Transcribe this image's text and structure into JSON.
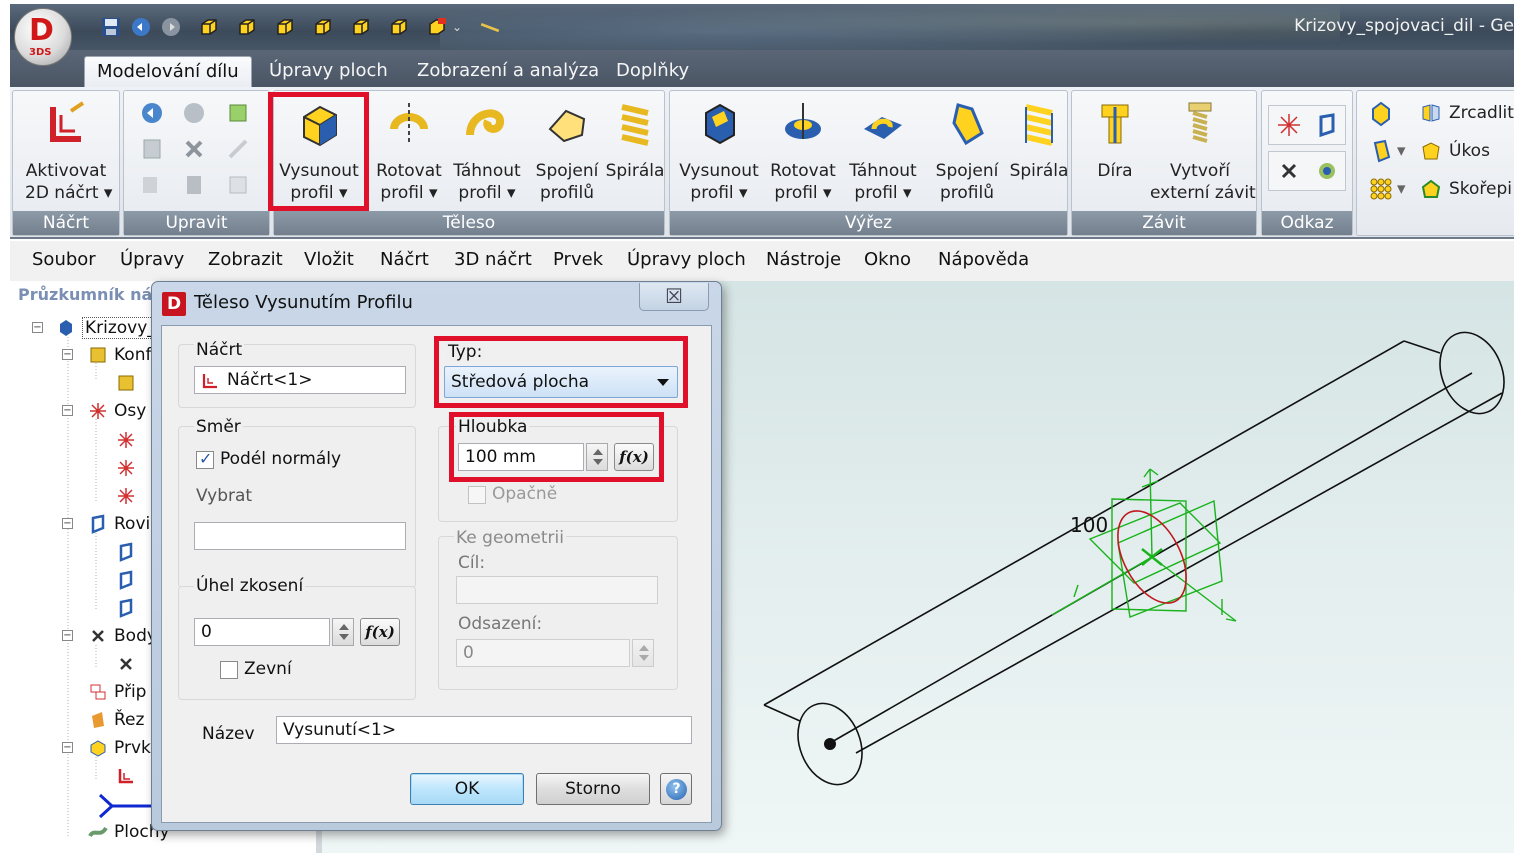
{
  "app": {
    "title": "Krizovy_spojovaci_dil - Ge",
    "orb_letter": "D",
    "orb_sub": "3DS"
  },
  "ribbon_tabs": [
    {
      "label": "Modelování dílu",
      "active": true
    },
    {
      "label": "Úpravy ploch",
      "active": false
    },
    {
      "label": "Zobrazení a analýza",
      "active": false
    },
    {
      "label": "Doplňky",
      "active": false
    }
  ],
  "ribbon": {
    "groups": {
      "nacrt": "Náčrt",
      "upravit": "Upravit",
      "teleso": "Těleso",
      "vyrez": "Výřez",
      "zavit": "Závit",
      "odkaz": "Odkaz"
    },
    "aktivovat": {
      "line1": "Aktivovat",
      "line2": "2D náčrt ▾"
    },
    "teleso_buttons": [
      {
        "line1": "Vysunout",
        "line2": "profil ▾"
      },
      {
        "line1": "Rotovat",
        "line2": "profil ▾"
      },
      {
        "line1": "Táhnout",
        "line2": "profil ▾"
      },
      {
        "line1": "Spojení",
        "line2": "profilů"
      },
      {
        "line1": "Spirála",
        "line2": ""
      }
    ],
    "vyrez_buttons": [
      {
        "line1": "Vysunout",
        "line2": "profil ▾"
      },
      {
        "line1": "Rotovat",
        "line2": "profil ▾"
      },
      {
        "line1": "Táhnout",
        "line2": "profil ▾"
      },
      {
        "line1": "Spojení",
        "line2": "profilů"
      },
      {
        "line1": "Spirála",
        "line2": ""
      }
    ],
    "zavit_buttons": [
      {
        "line1": "Díra",
        "line2": ""
      },
      {
        "line1": "Vytvoří",
        "line2": "externí závit"
      }
    ],
    "right_small": [
      "Zrcadlit",
      "Úkos",
      "Skořepi"
    ]
  },
  "menubar": [
    "Soubor",
    "Úpravy",
    "Zobrazit",
    "Vložit",
    "Náčrt",
    "3D náčrt",
    "Prvek",
    "Úpravy ploch",
    "Nástroje",
    "Okno",
    "Nápověda"
  ],
  "tree": {
    "title": "Průzkumník náv",
    "root": "Krizovy_",
    "nodes": [
      "Konf",
      "",
      "Osy",
      "",
      "",
      "",
      "Rovi",
      "",
      "",
      "",
      "Body",
      "",
      "Přip",
      "Řez",
      "Prvk",
      "",
      "Plochy"
    ]
  },
  "viewport": {
    "dimension_label": "100"
  },
  "dialog": {
    "title": "Těleso Vysunutím Profilu",
    "close_glyph": "☒",
    "nacrt": {
      "legend": "Náčrt",
      "value": "Náčrt<1>"
    },
    "smer": {
      "legend": "Směr",
      "podel_normaly": "Podél normály",
      "podel_checked": true,
      "vybrat": "Vybrat",
      "vybrat_value": ""
    },
    "uhel": {
      "legend": "Úhel zkosení",
      "value": "0",
      "zevni": "Zevní",
      "fx": "f(x)"
    },
    "typ": {
      "legend": "Typ:",
      "value": "Středová plocha"
    },
    "hloubka": {
      "legend": "Hloubka",
      "value": "100 mm",
      "fx": "f(x)",
      "opacne": "Opačně"
    },
    "ke_geometrii": {
      "legend": "Ke geometrii",
      "cil": "Cíl:",
      "cil_value": "",
      "odsazeni": "Odsazení:",
      "odsazeni_value": "0"
    },
    "nazev": {
      "label": "Název",
      "value": "Vysunutí<1>"
    },
    "ok": "OK",
    "storno": "Storno",
    "help": "?"
  },
  "colors": {
    "highlight": "#e0102a",
    "sketch_green": "#19b31b",
    "sketch_red": "#c0181e"
  }
}
